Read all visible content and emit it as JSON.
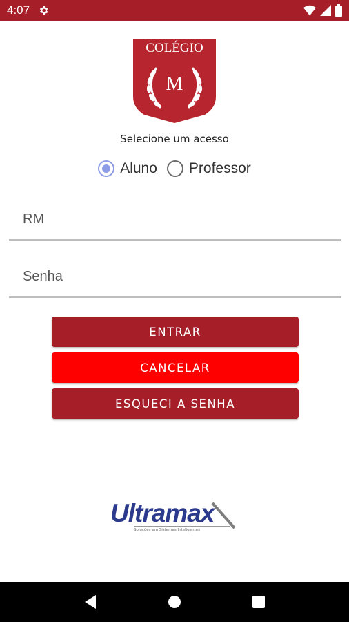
{
  "status_bar": {
    "time": "4:07",
    "icons": [
      "settings-icon",
      "wifi-icon",
      "signal-icon",
      "battery-icon"
    ]
  },
  "logo": {
    "top_text": "COLÉGIO",
    "letter": "M",
    "color": "#b7262e"
  },
  "access": {
    "title": "Selecione um acesso",
    "options": [
      {
        "label": "Aluno",
        "checked": true
      },
      {
        "label": "Professor",
        "checked": false
      }
    ]
  },
  "form": {
    "rm_placeholder": "RM",
    "rm_value": "",
    "password_placeholder": "Senha",
    "password_value": ""
  },
  "buttons": {
    "enter": "ENTRAR",
    "cancel": "CANCELAR",
    "forgot": "ESQUECI A SENHA"
  },
  "brand": {
    "name": "Ultramax",
    "tagline": "Soluções em Sistemas Inteligentes"
  },
  "nav_bar": {
    "icons": [
      "back-icon",
      "home-icon",
      "recents-icon"
    ]
  },
  "colors": {
    "primary": "#a51e28",
    "danger": "#ff0000",
    "radio_accent": "#8e9be6",
    "brand_blue": "#2b3a8c"
  }
}
